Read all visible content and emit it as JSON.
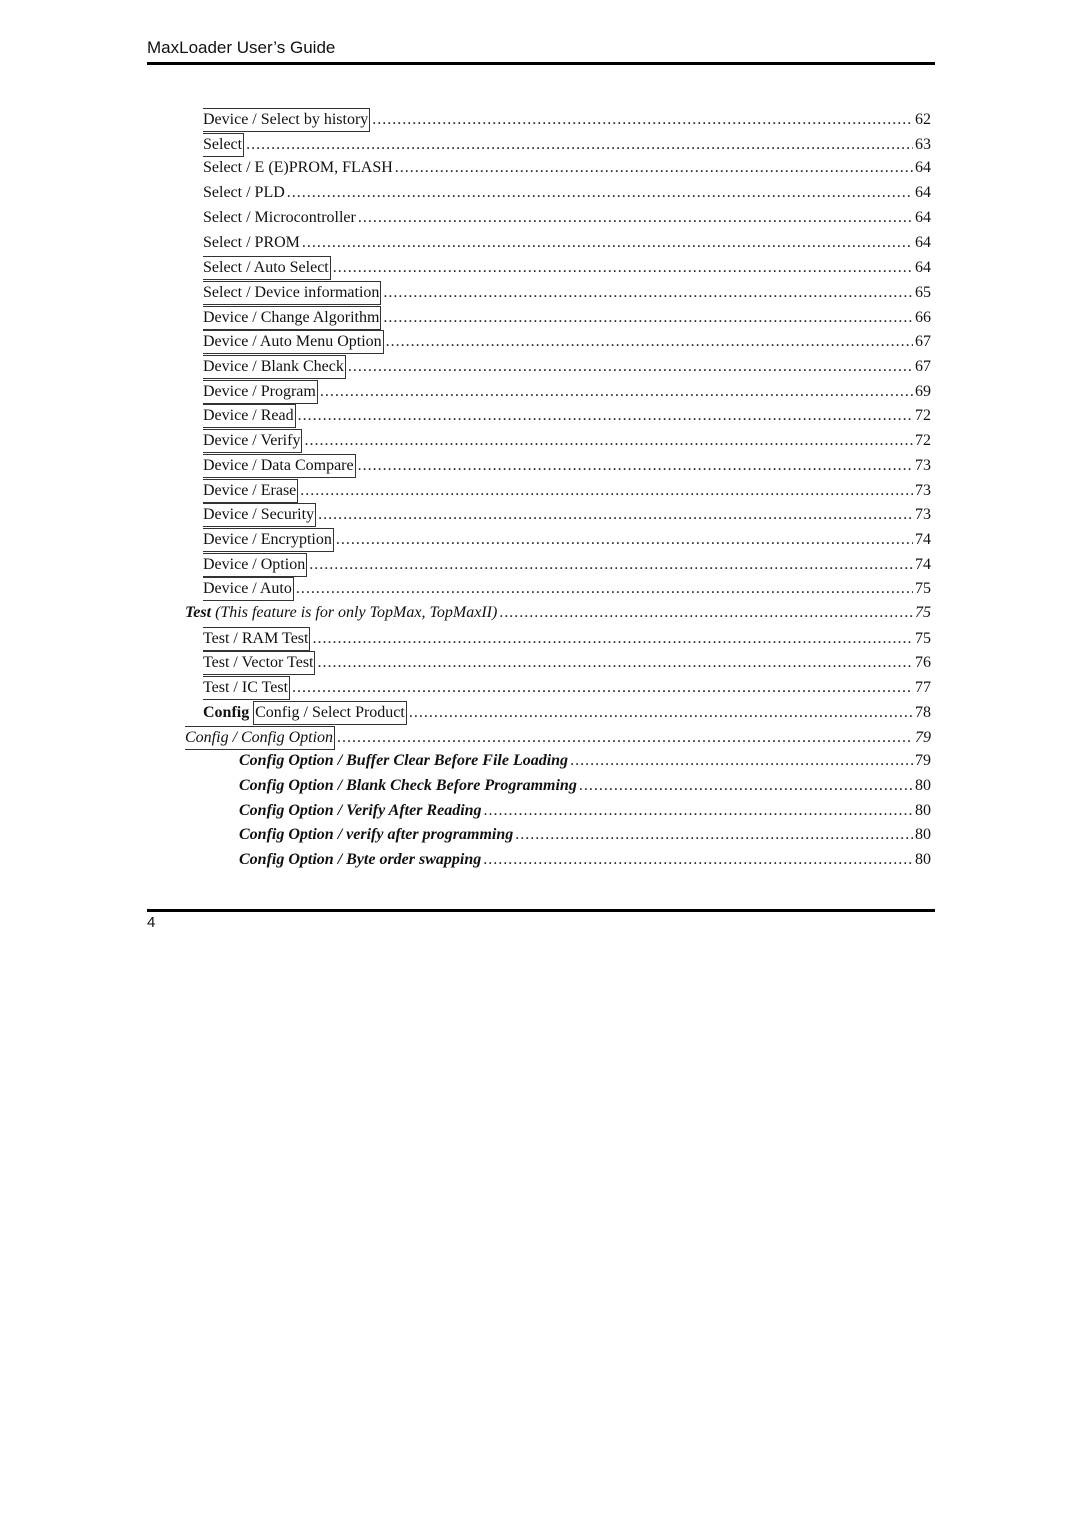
{
  "header": {
    "title": "MaxLoader User’s Guide"
  },
  "footer": {
    "page_number": "4"
  },
  "toc": [
    {
      "label": "Device / Select by history",
      "page": "62",
      "level": 2,
      "boxed": true,
      "style": "normal"
    },
    {
      "label": "Select",
      "page": "63",
      "level": 2,
      "boxed": true,
      "style": "normal"
    },
    {
      "label": "Select / E (E)PROM, FLASH",
      "page": "64",
      "level": 2,
      "boxed": false,
      "style": "normal"
    },
    {
      "label": "Select / PLD",
      "page": "64",
      "level": 2,
      "boxed": false,
      "style": "normal"
    },
    {
      "label": "Select / Microcontroller",
      "page": "64",
      "level": 2,
      "boxed": false,
      "style": "normal"
    },
    {
      "label": "Select / PROM",
      "page": "64",
      "level": 2,
      "boxed": false,
      "style": "normal"
    },
    {
      "label": "Select / Auto Select",
      "page": "64",
      "level": 2,
      "boxed": true,
      "style": "normal"
    },
    {
      "label": "Select / Device information",
      "page": "65",
      "level": 2,
      "boxed": true,
      "style": "normal"
    },
    {
      "label": "Device / Change Algorithm",
      "page": "66",
      "level": 2,
      "boxed": true,
      "style": "normal"
    },
    {
      "label": "Device / Auto Menu Option",
      "page": "67",
      "level": 2,
      "boxed": true,
      "style": "normal"
    },
    {
      "label": "Device / Blank Check",
      "page": "67",
      "level": 2,
      "boxed": true,
      "style": "normal"
    },
    {
      "label": "Device / Program",
      "page": "69",
      "level": 2,
      "boxed": true,
      "style": "normal"
    },
    {
      "label": "Device / Read",
      "page": "72",
      "level": 2,
      "boxed": true,
      "style": "normal"
    },
    {
      "label": "Device / Verify",
      "page": "72",
      "level": 2,
      "boxed": true,
      "style": "normal"
    },
    {
      "label": "Device / Data Compare",
      "page": "73",
      "level": 2,
      "boxed": true,
      "style": "normal"
    },
    {
      "label": "Device / Erase",
      "page": "73",
      "level": 2,
      "boxed": true,
      "style": "normal"
    },
    {
      "label": "Device / Security",
      "page": "73",
      "level": 2,
      "boxed": true,
      "style": "normal"
    },
    {
      "label": "Device / Encryption",
      "page": "74",
      "level": 2,
      "boxed": true,
      "style": "normal"
    },
    {
      "label": "Device / Option",
      "page": "74",
      "level": 2,
      "boxed": true,
      "style": "normal"
    },
    {
      "label": "Device / Auto",
      "page": "75",
      "level": 2,
      "boxed": true,
      "style": "normal"
    },
    {
      "label_bold": "Test",
      "label": " (This feature is for only TopMax, TopMaxII)",
      "page": "75",
      "level": 1,
      "boxed": false,
      "style": "italic"
    },
    {
      "label": "Test / RAM Test",
      "page": "75",
      "level": 2,
      "boxed": true,
      "style": "normal"
    },
    {
      "label": "Test / Vector Test",
      "page": "76",
      "level": 2,
      "boxed": true,
      "style": "normal"
    },
    {
      "label": "Test / IC Test",
      "page": "77",
      "level": 2,
      "boxed": true,
      "style": "normal"
    },
    {
      "prefix": "Config",
      "label": "Config / Select Product",
      "page": "78",
      "level": 2,
      "boxed": true,
      "style": "normal"
    },
    {
      "label": "Config / Config Option",
      "page": "79",
      "level": 1,
      "boxed": true,
      "style": "italic"
    },
    {
      "label": "Config Option / Buffer Clear Before File Loading",
      "page": "79",
      "level": 3,
      "boxed": false,
      "style": "bolditalic"
    },
    {
      "label": "Config Option / Blank Check Before Programming",
      "page": "80",
      "level": 3,
      "boxed": false,
      "style": "bolditalic"
    },
    {
      "label": "Config Option / Verify After Reading",
      "page": "80",
      "level": 3,
      "boxed": false,
      "style": "bolditalic"
    },
    {
      "label": "Config Option / verify after programming",
      "page": "80",
      "level": 3,
      "boxed": false,
      "style": "bolditalic"
    },
    {
      "label": "Config Option / Byte order swapping",
      "page": "80",
      "level": 3,
      "boxed": false,
      "style": "bolditalic"
    }
  ]
}
